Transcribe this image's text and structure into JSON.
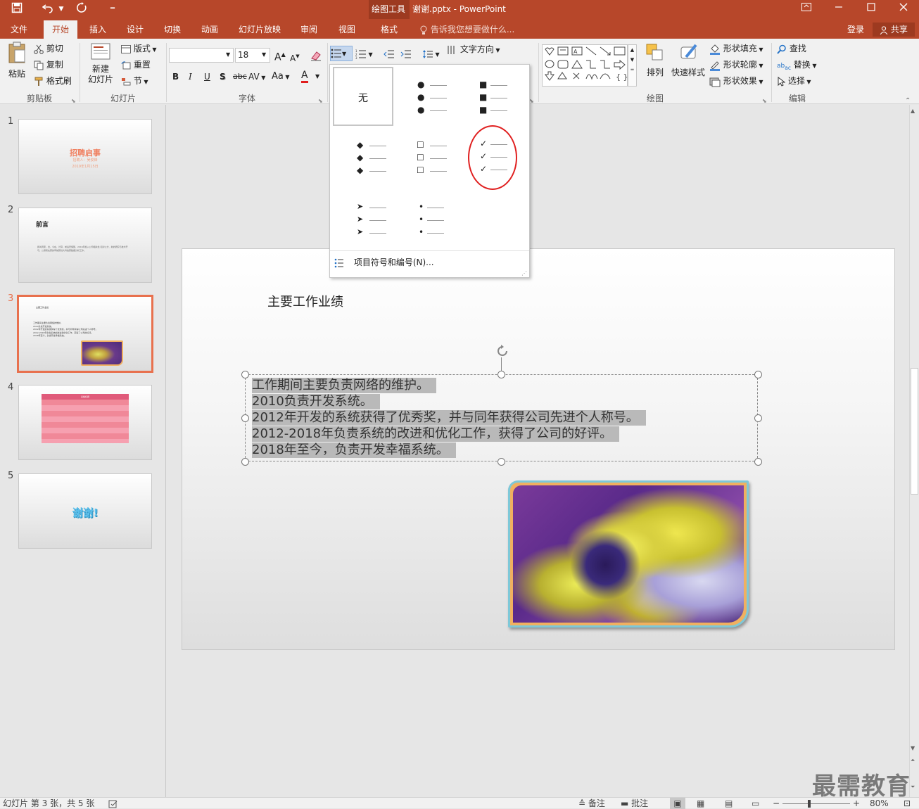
{
  "window": {
    "title_text": "谢谢.pptx - PowerPoint",
    "context_tool_label": "绘图工具",
    "quick_access": [
      "save-icon",
      "undo-icon",
      "redo-icon",
      "customize-icon"
    ]
  },
  "tabs": [
    {
      "label": "文件",
      "active": false
    },
    {
      "label": "开始",
      "active": true
    },
    {
      "label": "插入",
      "active": false
    },
    {
      "label": "设计",
      "active": false
    },
    {
      "label": "切换",
      "active": false
    },
    {
      "label": "动画",
      "active": false
    },
    {
      "label": "幻灯片放映",
      "active": false
    },
    {
      "label": "审阅",
      "active": false
    },
    {
      "label": "视图",
      "active": false
    },
    {
      "label": "格式",
      "active": false
    }
  ],
  "tellme": "告诉我您想要做什么...",
  "signin": "登录",
  "share": "共享",
  "ribbon": {
    "clipboard": {
      "paste": "粘贴",
      "cut": "剪切",
      "copy": "复制",
      "format_painter": "格式刷",
      "label": "剪贴板"
    },
    "slides": {
      "new_slide_line1": "新建",
      "new_slide_line2": "幻灯片",
      "layout": "版式",
      "reset": "重置",
      "section": "节",
      "label": "幻灯片"
    },
    "font": {
      "font_name": "",
      "font_size": "18",
      "bold": "B",
      "italic": "I",
      "underline": "U",
      "shadow": "S",
      "strike": "abc",
      "spacing": "AV",
      "case": "Aa",
      "color": "A",
      "grow": "A",
      "shrink": "A",
      "label": "字体"
    },
    "paragraph": {
      "text_direction": "文字方向"
    },
    "drawing": {
      "arrange": "排列",
      "quick_styles": "快速样式",
      "shape_fill": "形状填充",
      "shape_outline": "形状轮廓",
      "shape_effects": "形状效果",
      "label": "绘图"
    },
    "editing": {
      "find": "查找",
      "replace": "替换",
      "select": "选择",
      "label": "编辑"
    }
  },
  "bullet_menu": {
    "none_label": "无",
    "options": [
      {
        "name": "none"
      },
      {
        "name": "filled-round",
        "symbol": "●"
      },
      {
        "name": "filled-square",
        "symbol": "■"
      },
      {
        "name": "diamond",
        "symbol": "◆"
      },
      {
        "name": "hollow-square",
        "symbol": "☐"
      },
      {
        "name": "checkmark",
        "symbol": "✓",
        "highlighted": true
      },
      {
        "name": "arrow",
        "symbol": "➤"
      },
      {
        "name": "small-dot",
        "symbol": "•"
      }
    ],
    "footer_label": "项目符号和编号(N)..."
  },
  "thumbnails": [
    {
      "num": "1",
      "title": "招聘启事",
      "subtitle": "招聘人：吴俊锋",
      "date": "2019年1月15日"
    },
    {
      "num": "2",
      "title": "前言",
      "body": "我叫周家，出，今在，计算，前后安保部，2016年加入公司相关性 和对公分、新的研究与技术开与，公测来在研的司前研创大科技研数据分析工作。"
    },
    {
      "num": "3",
      "selected": true,
      "title": "主要工作业绩",
      "lines": [
        "工作期间主要负责网络的维护。",
        "2010负责开发系统。",
        "2012年开发的系统获得了优秀奖，并与同年获得公司先进个人称号。",
        "2012-2018年负责系统的改进和优化工作，获得了公司的好评。",
        "2018年至今，负责开发幸福系统。"
      ]
    },
    {
      "num": "4",
      "table_header": "表格标题"
    },
    {
      "num": "5",
      "title": "谢谢!"
    }
  ],
  "slide": {
    "title": "主要工作业绩",
    "body_lines": [
      "工作期间主要负责网络的维护。",
      "2010负责开发系统。",
      "2012年开发的系统获得了优秀奖，并与同年获得公司先进个人称号。",
      "2012-2018年负责系统的改进和优化工作，获得了公司的好评。",
      "2018年至今，负责开发幸福系统。"
    ]
  },
  "status": {
    "slide_info": "幻灯片 第 3 张，共 5 张",
    "notes": "备注",
    "comments": "批注",
    "zoom": "80%"
  },
  "watermark": "最需教育",
  "colors": {
    "accent": "#b7472a",
    "selection_border": "#e8714e",
    "highlight_circle": "#e02020"
  }
}
